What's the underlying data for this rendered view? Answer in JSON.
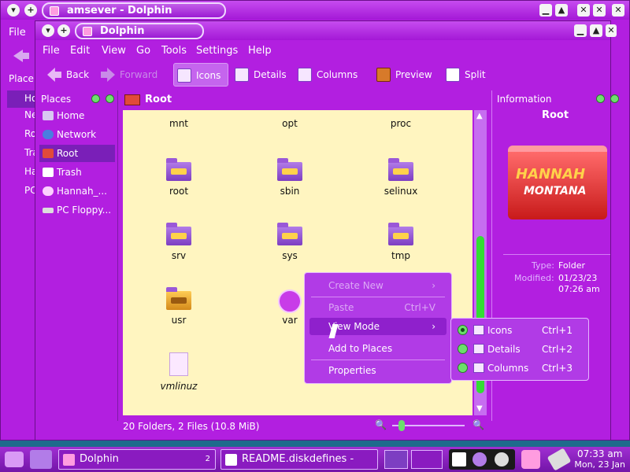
{
  "back_window": {
    "title": "amsever - Dolphin",
    "menu_file": "File",
    "places_label": "Place",
    "places": [
      "Ho",
      "Ne",
      "Ro",
      "Tra",
      "Ha",
      "PC"
    ]
  },
  "window": {
    "title": "Dolphin",
    "menu": [
      "File",
      "Edit",
      "View",
      "Go",
      "Tools",
      "Settings",
      "Help"
    ],
    "toolbar": {
      "back": "Back",
      "forward": "Forward",
      "icons": "Icons",
      "details": "Details",
      "columns": "Columns",
      "preview": "Preview",
      "split": "Split"
    }
  },
  "places_panel": {
    "title": "Places",
    "items": [
      {
        "label": "Home",
        "color": "#d9c7f2"
      },
      {
        "label": "Network",
        "color": "#4a7de0"
      },
      {
        "label": "Root",
        "color": "#e14a3a"
      },
      {
        "label": "Trash",
        "color": "#ffffff"
      },
      {
        "label": "Hannah_...",
        "color": "#fcd0ff"
      },
      {
        "label": "PC Floppy...",
        "color": "#dddddd"
      }
    ],
    "selected": "Root"
  },
  "location": {
    "label": "Root"
  },
  "files": [
    {
      "name": "mnt"
    },
    {
      "name": "opt"
    },
    {
      "name": "proc"
    },
    {
      "name": "root"
    },
    {
      "name": "sbin"
    },
    {
      "name": "selinux"
    },
    {
      "name": "srv"
    },
    {
      "name": "sys"
    },
    {
      "name": "tmp"
    },
    {
      "name": "usr"
    },
    {
      "name": "var"
    },
    {
      "name": "vmlinuz"
    }
  ],
  "info_panel": {
    "title": "Information",
    "name": "Root",
    "logo_line1": "HANNAH",
    "logo_line2": "MONTANA",
    "type_label": "Type:",
    "type_value": "Folder",
    "modified_label": "Modified:",
    "modified_date": "01/23/23",
    "modified_time": "07:26 am"
  },
  "status": {
    "text": "20 Folders, 2 Files (10.8 MiB)"
  },
  "context_menu": {
    "create_new": "Create New",
    "paste": "Paste",
    "paste_shortcut": "Ctrl+V",
    "view_mode": "View Mode",
    "add_to_places": "Add to Places",
    "properties": "Properties"
  },
  "view_mode_menu": [
    {
      "label": "Icons",
      "shortcut": "Ctrl+1",
      "selected": true
    },
    {
      "label": "Details",
      "shortcut": "Ctrl+2",
      "selected": false
    },
    {
      "label": "Columns",
      "shortcut": "Ctrl+3",
      "selected": false
    }
  ],
  "taskbar": {
    "task1": "Dolphin",
    "task1_count": "2",
    "task2": "README.diskdefines - Kate",
    "time": "07:33 am",
    "date": "Mon, 23 Jan"
  },
  "colors": {
    "window": "#b21fe0",
    "content": "#fff5c0",
    "accent_green": "#33dd33"
  }
}
